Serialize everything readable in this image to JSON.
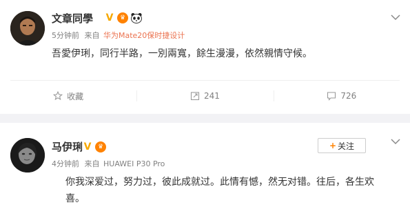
{
  "posts": [
    {
      "username": "文章同學",
      "time": "5分钟前",
      "source_prefix": "来自",
      "source": "华为Mate20保时捷设计",
      "content": "吾愛伊琍，同行半路，一別兩寬，餘生漫漫，依然親情守候。",
      "actions": {
        "favorite_label": "收藏",
        "repost_count": "241",
        "comment_count": "726"
      }
    },
    {
      "username": "马伊琍",
      "time": "4分钟前",
      "source_prefix": "来自",
      "source": "HUAWEI P30 Pro",
      "follow_label": "关注",
      "content": "你我深爱过，努力过，彼此成就过。此情有憾，然无对错。往后，各生欢喜。"
    }
  ],
  "colors": {
    "link": "#eb7350",
    "accent": "#ff8200",
    "verified": "#f7a800",
    "muted": "#808080"
  },
  "icons": [
    "verified-v-icon",
    "vip-icon",
    "panda-icon",
    "chevron-down-icon",
    "favorite-icon",
    "repost-icon",
    "comment-icon",
    "plus-icon"
  ]
}
